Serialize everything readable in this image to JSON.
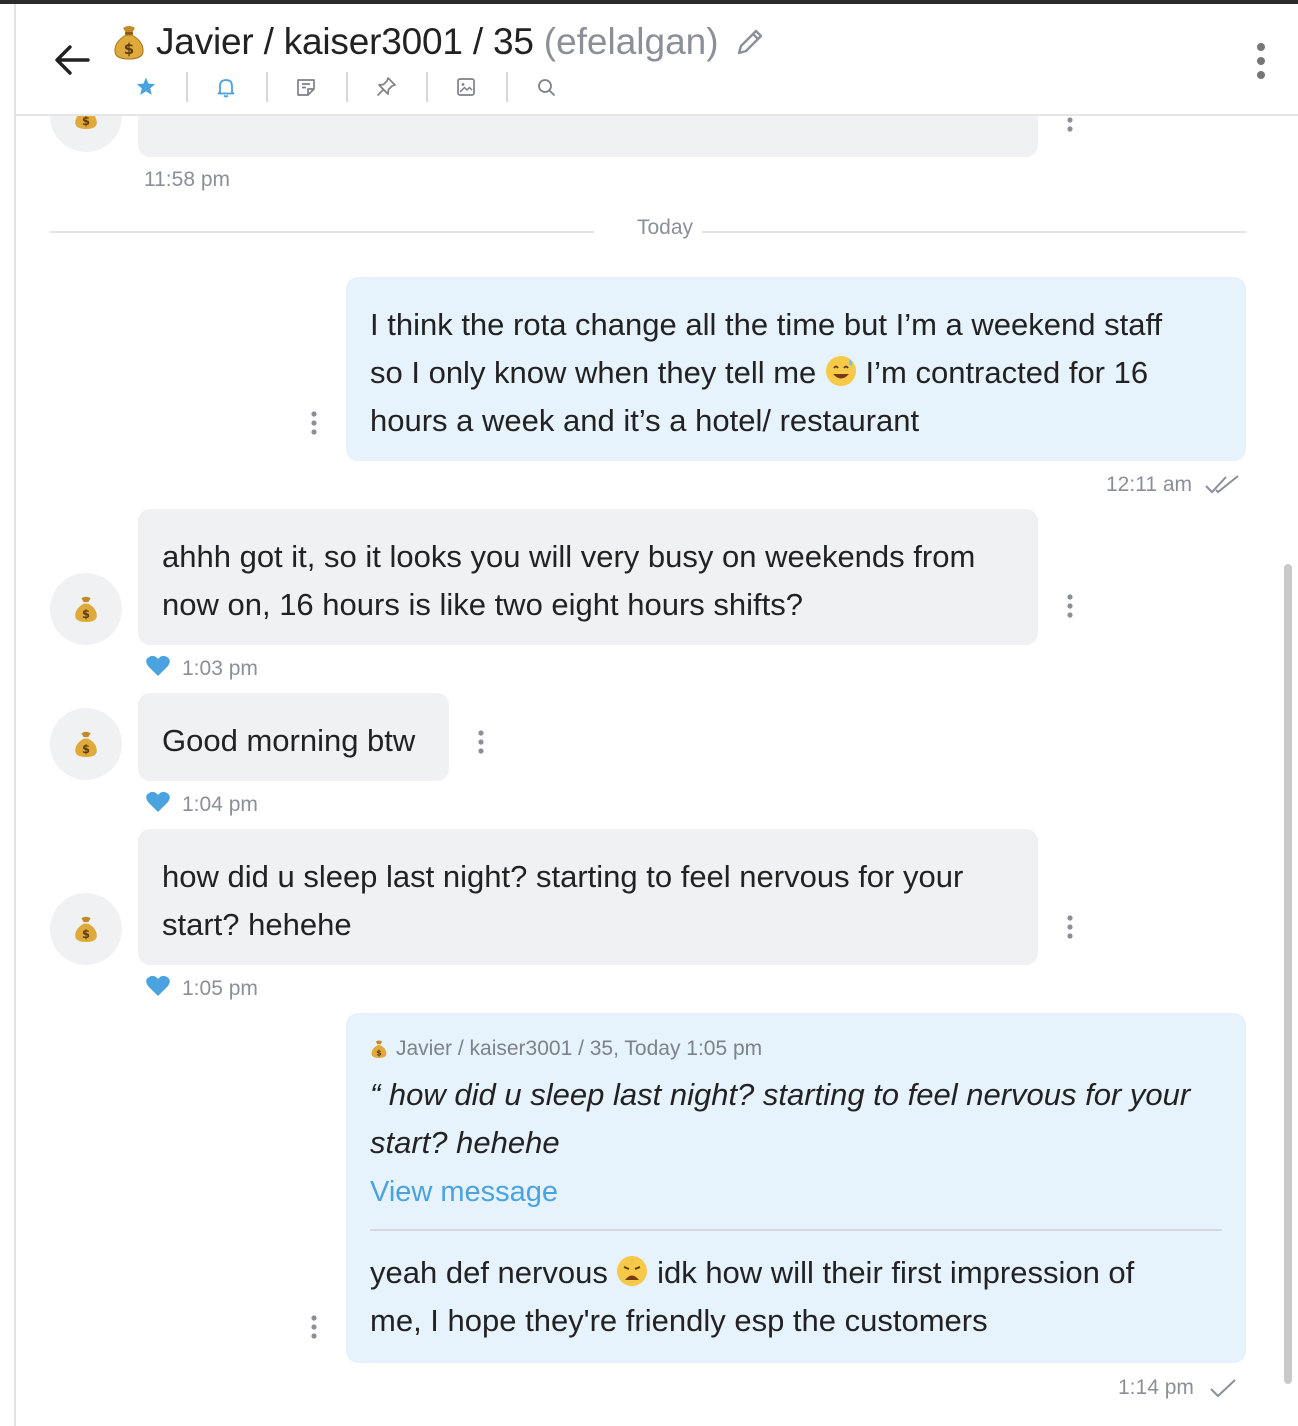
{
  "header": {
    "title": "Javier / kaiser3001 / 35",
    "alias": "(efelalgan)",
    "toolbar": [
      "star-icon",
      "bell-icon",
      "note-icon",
      "pin-icon",
      "image-icon",
      "search-icon"
    ]
  },
  "colors": {
    "accent": "#4aa3df",
    "incoming_bubble": "#f0f1f3",
    "outgoing_bubble": "#e6f2fc"
  },
  "chat": {
    "prev_message_time": "11:58 pm",
    "date_divider": "Today",
    "messages": [
      {
        "direction": "outgoing",
        "line1": "I think the rota change all the time but I’m a weekend staff",
        "line2a": "so I only know when they tell me",
        "line2b": "I’m contracted for 16",
        "line3": "hours a week and it’s a hotel/ restaurant",
        "time": "12:11 am",
        "status": "read"
      },
      {
        "direction": "incoming",
        "line1": "ahhh got it, so it looks you will very busy on weekends from",
        "line2": "now on, 16 hours is like two eight hours shifts?",
        "time": "1:03 pm",
        "liked": true
      },
      {
        "direction": "incoming",
        "line1": "Good morning btw",
        "time": "1:04 pm",
        "liked": true
      },
      {
        "direction": "incoming",
        "line1": "how did u sleep last night? starting to feel nervous for your",
        "line2": "start? hehehe",
        "time": "1:05 pm",
        "liked": true
      },
      {
        "direction": "outgoing",
        "quote": {
          "header": "Javier / kaiser3001 / 35, Today 1:05 pm",
          "line1": "“ how did u sleep last night? starting to feel nervous for your",
          "line2": "start? hehehe",
          "link": "View message"
        },
        "line1a": "yeah def nervous",
        "line1b": "idk how will their first impression of",
        "line2": "me, I hope they're friendly esp the customers",
        "time": "1:14 pm",
        "status": "sent"
      }
    ]
  }
}
